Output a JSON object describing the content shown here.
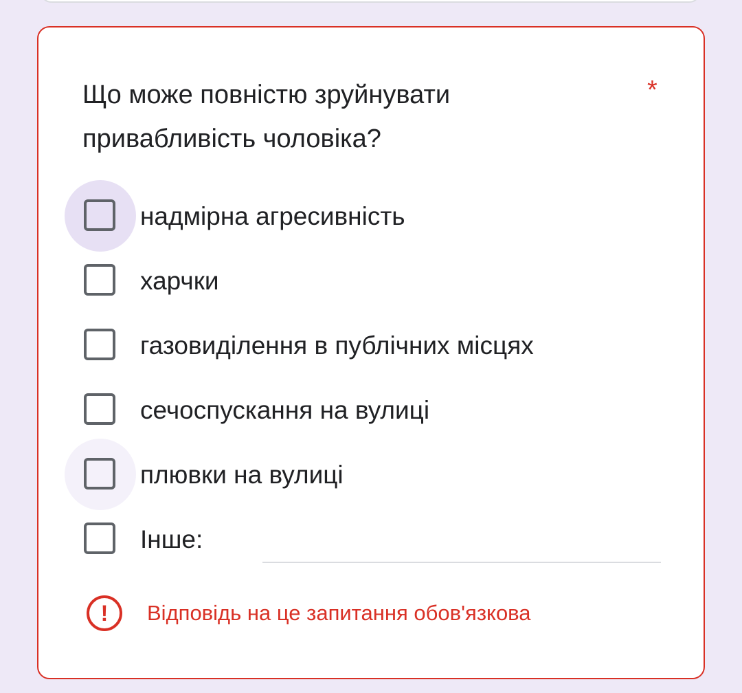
{
  "question": {
    "title": "Що може повністю зруйнувати привабливість чоловіка?",
    "required_mark": "*"
  },
  "options": [
    {
      "label": "надмірна агресивність",
      "checked": false
    },
    {
      "label": "харчки",
      "checked": false
    },
    {
      "label": "газовиділення в публічних місцях",
      "checked": false
    },
    {
      "label": "сечоспускання на вулиці",
      "checked": false
    },
    {
      "label": "плювки на вулиці",
      "checked": false
    },
    {
      "label": "Інше:",
      "checked": false
    }
  ],
  "other_input": {
    "value": "",
    "placeholder": ""
  },
  "error": {
    "icon": "alert-circle-icon",
    "glyph": "!",
    "message": "Відповідь на це запитання обов'язкова"
  },
  "colors": {
    "error": "#d93025",
    "background": "#eee9f7",
    "checkbox_border": "#5f6368",
    "highlight": "#e7e0f4"
  }
}
